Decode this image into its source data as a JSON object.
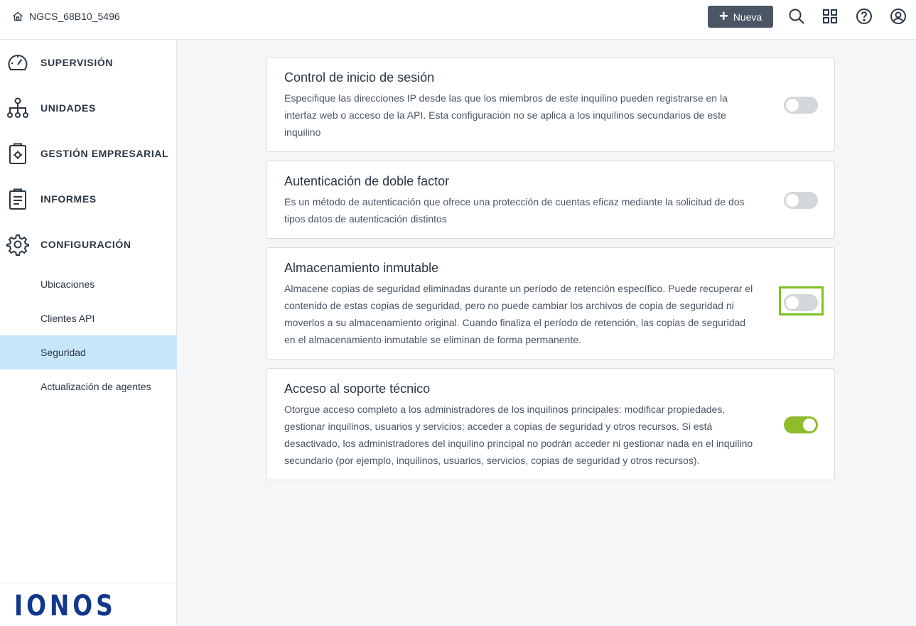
{
  "header": {
    "tenant_name": "NGCS_68B10_5496",
    "new_button_label": "Nueva",
    "icons": [
      "search-icon",
      "grid-icon",
      "help-icon",
      "user-icon"
    ]
  },
  "sidebar": {
    "main_items": [
      {
        "label": "SUPERVISIÓN",
        "icon": "gauge-icon"
      },
      {
        "label": "UNIDADES",
        "icon": "hierarchy-icon"
      },
      {
        "label": "GESTIÓN EMPRESARIAL",
        "icon": "clipboard-gear-icon"
      },
      {
        "label": "INFORMES",
        "icon": "report-icon"
      },
      {
        "label": "CONFIGURACIÓN",
        "icon": "gear-icon"
      }
    ],
    "sub_items": [
      {
        "label": "Ubicaciones",
        "active": false
      },
      {
        "label": "Clientes API",
        "active": false
      },
      {
        "label": "Seguridad",
        "active": true
      },
      {
        "label": "Actualización de agentes",
        "active": false
      }
    ],
    "logo_text": "IONOS"
  },
  "settings": [
    {
      "title": "Control de inicio de sesión",
      "description": "Especifique las direcciones IP desde las que los miembros de este inquilino pueden registrarse en la interfaz web o acceso de la API. Esta configuración no se aplica a los inquilinos secundarios de este inquilino",
      "enabled": false
    },
    {
      "title": "Autenticación de doble factor",
      "description": "Es un método de autenticación que ofrece una protección de cuentas eficaz mediante la solicitud de dos tipos datos de autenticación distintos",
      "enabled": false
    },
    {
      "title": "Almacenamiento inmutable",
      "description": "Almacene copias de seguridad eliminadas durante un período de retención específico. Puede recuperar el contenido de estas copias de seguridad, pero no puede cambiar los archivos de copia de seguridad ni moverlos a su almacenamiento original. Cuando finaliza el período de retención, las copias de seguridad en el almacenamiento inmutable se eliminan de forma permanente.",
      "enabled": false,
      "highlighted": true
    },
    {
      "title": "Acceso al soporte técnico",
      "description": "Otorgue acceso completo a los administradores de los inquilinos principales: modificar propiedades, gestionar inquilinos, usuarios y servicios; acceder a copias de seguridad y otros recursos. Si está desactivado, los administradores del inquilino principal no podrán acceder ni gestionar nada en el inquilino secundario (por ejemplo, inquilinos, usuarios, servicios, copias de seguridad y otros recursos).",
      "enabled": true
    }
  ],
  "colors": {
    "toggle_on": "#8ebc2c",
    "toggle_off": "#d3d7dc",
    "highlight": "#7cc222",
    "active_nav": "#c8e6fa",
    "logo": "#11388c",
    "button": "#4a5663"
  }
}
